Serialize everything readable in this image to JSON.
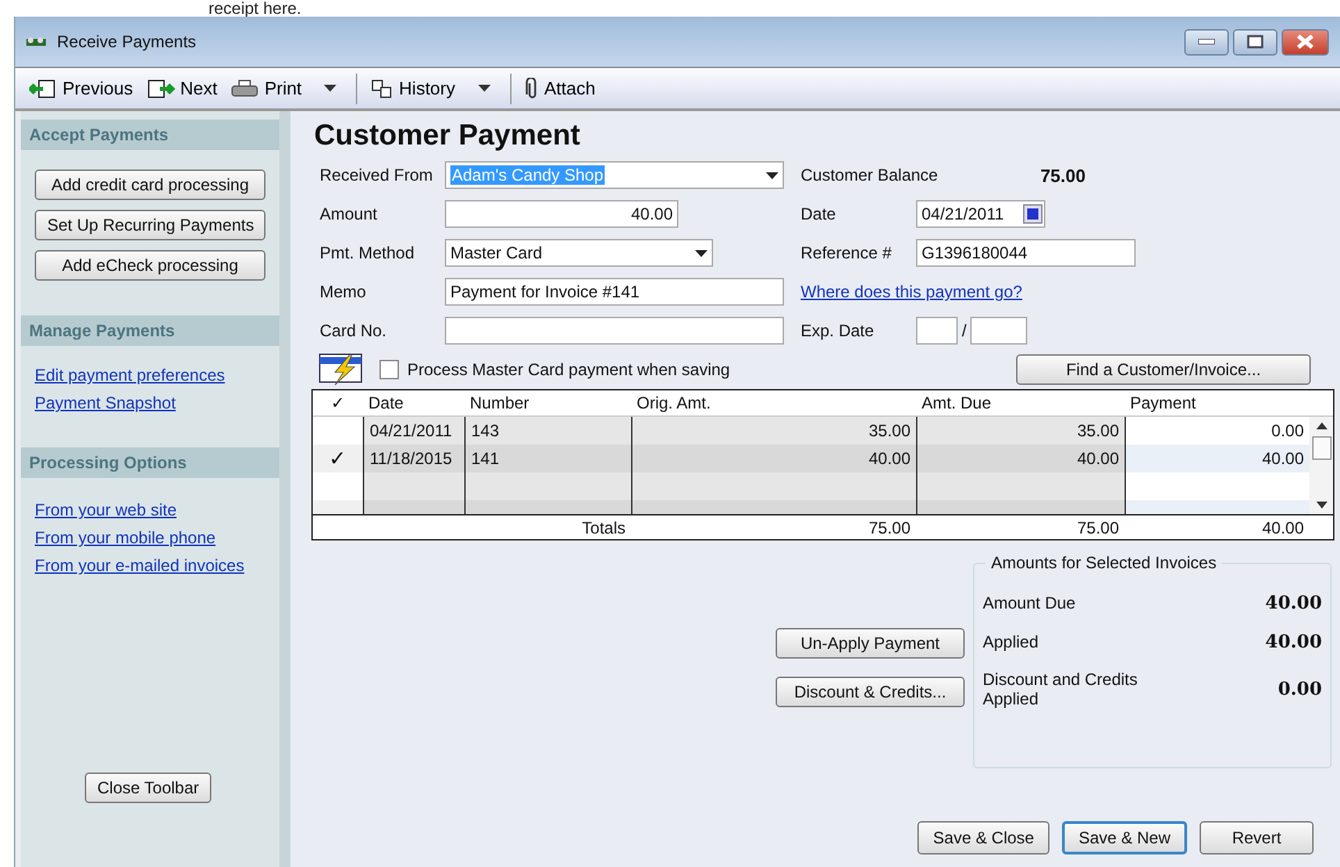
{
  "doc_text": "receipt here.",
  "window": {
    "title": "Receive Payments"
  },
  "toolbar": [
    {
      "kind": "previous",
      "label": "Previous",
      "dropdown": false
    },
    {
      "kind": "next",
      "label": "Next",
      "dropdown": false
    },
    {
      "kind": "print",
      "label": "Print",
      "dropdown": true
    },
    {
      "kind": "history",
      "label": "History",
      "dropdown": true
    },
    {
      "kind": "attach",
      "label": "Attach",
      "dropdown": false
    }
  ],
  "sidebar": {
    "sections": [
      {
        "title": "Accept Payments",
        "kind": "buttons",
        "items": [
          "Add credit card processing",
          "Set Up Recurring Payments",
          "Add eCheck processing"
        ]
      },
      {
        "title": "Manage Payments",
        "kind": "links",
        "items": [
          "Edit payment preferences",
          "Payment Snapshot"
        ]
      },
      {
        "title": "Processing Options",
        "kind": "links",
        "items": [
          "From your web site",
          "From your mobile phone",
          "From your e-mailed invoices"
        ]
      }
    ],
    "close_button": "Close Toolbar"
  },
  "form": {
    "title": "Customer Payment",
    "received_from": {
      "label": "Received From",
      "value": "Adam's Candy Shop"
    },
    "customer_balance": {
      "label": "Customer Balance",
      "value": "75.00"
    },
    "amount": {
      "label": "Amount",
      "value": "40.00"
    },
    "date": {
      "label": "Date",
      "value": "04/21/2011"
    },
    "pmt_method": {
      "label": "Pmt. Method",
      "value": "Master Card"
    },
    "reference": {
      "label": "Reference #",
      "value": "G1396180044"
    },
    "memo": {
      "label": "Memo",
      "value": "Payment for Invoice #141"
    },
    "link": "Where does this payment go?",
    "card_no": {
      "label": "Card No."
    },
    "exp_date": {
      "label": "Exp. Date",
      "separator": "/"
    }
  },
  "process_checkbox": {
    "label": "Process Master Card payment when saving",
    "checked": false
  },
  "find_button": "Find a Customer/Invoice...",
  "table": {
    "columns": [
      "✓",
      "Date",
      "Number",
      "Orig. Amt.",
      "Amt. Due",
      "Payment"
    ],
    "rows": [
      {
        "checked": false,
        "date": "04/21/2011",
        "number": "143",
        "orig": "35.00",
        "due": "35.00",
        "payment": "0.00"
      },
      {
        "checked": true,
        "date": "11/18/2015",
        "number": "141",
        "orig": "40.00",
        "due": "40.00",
        "payment": "40.00"
      }
    ],
    "check_mark": "✓",
    "totals": {
      "label": "Totals",
      "orig": "75.00",
      "due": "75.00",
      "payment": "40.00"
    }
  },
  "action_buttons": [
    "Un-Apply Payment",
    "Discount & Credits..."
  ],
  "amounts": {
    "title": "Amounts for Selected Invoices",
    "rows": [
      {
        "label": "Amount Due",
        "value": "40.00"
      },
      {
        "label": "Applied",
        "value": "40.00"
      },
      {
        "label": "Discount and Credits Applied",
        "value": "0.00"
      }
    ]
  },
  "bottom_buttons": [
    {
      "label": "Save & Close",
      "default": false
    },
    {
      "label": "Save & New",
      "default": true
    },
    {
      "label": "Revert",
      "default": false
    }
  ]
}
